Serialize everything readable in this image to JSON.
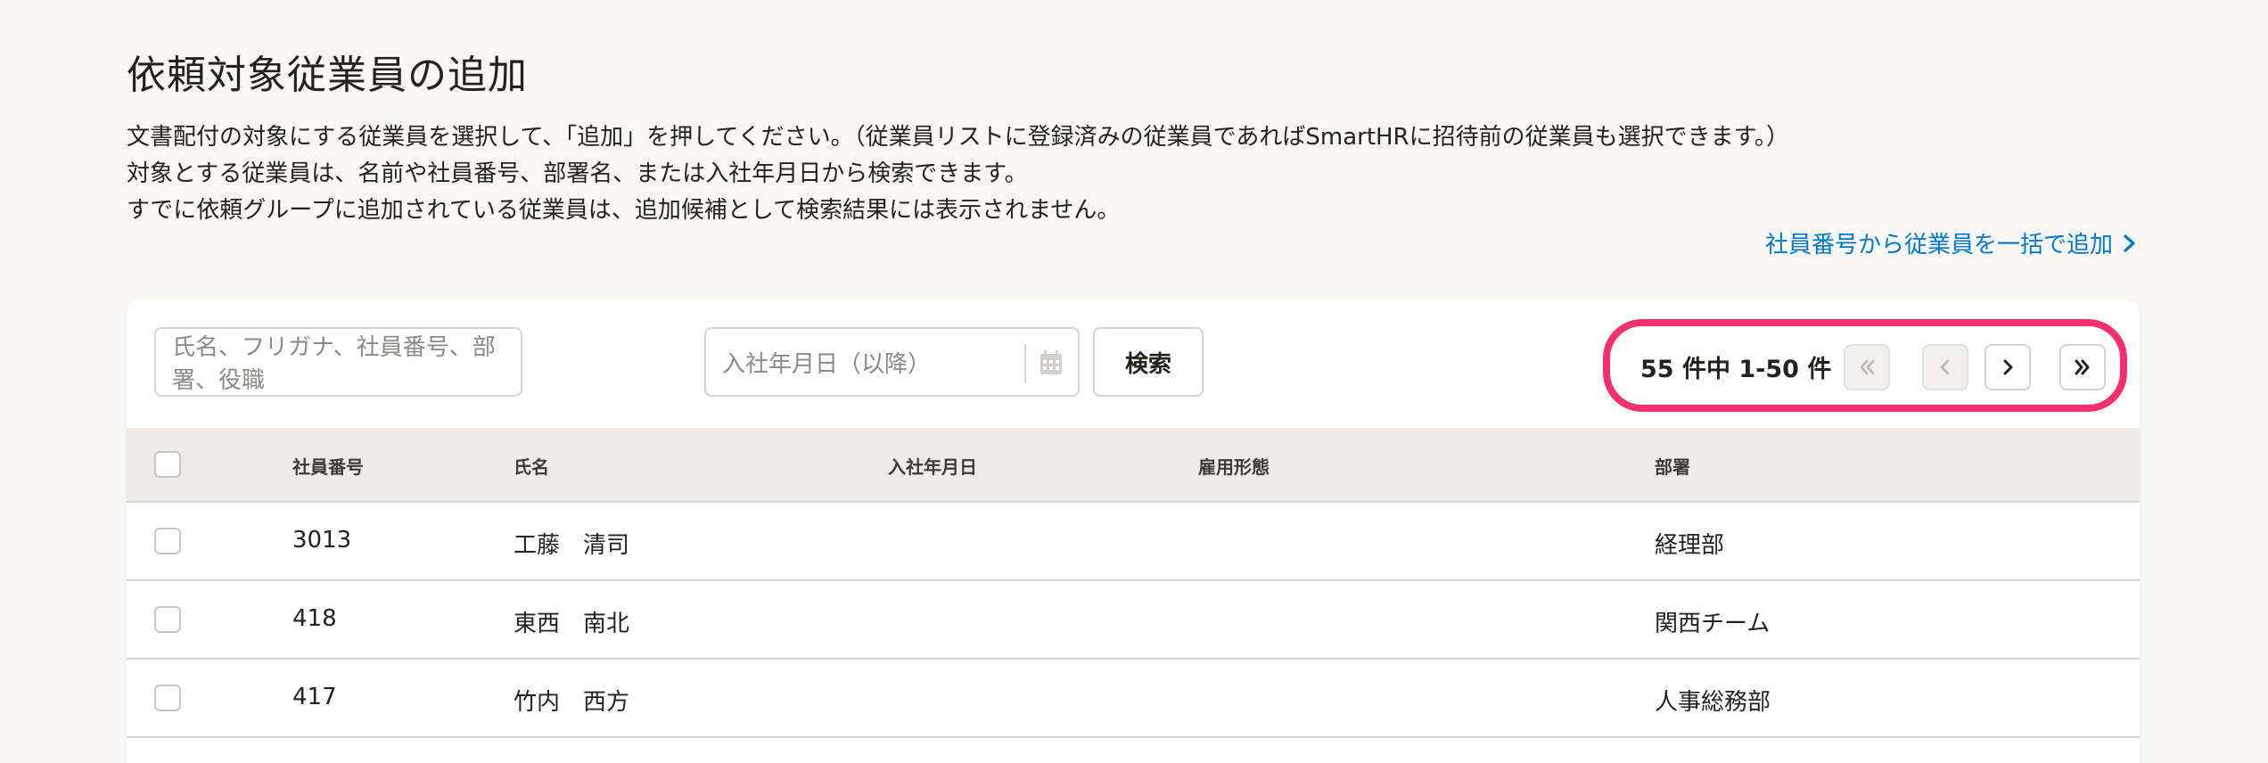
{
  "page": {
    "title": "依頼対象従業員の追加",
    "description": [
      "文書配付の対象にする従業員を選択して、「追加」を押してください。（従業員リストに登録済みの従業員であればSmartHRに招待前の従業員も選択できます。）",
      "対象とする従業員は、名前や社員番号、部署名、または入社年月日から検索できます。",
      "すでに依頼グループに追加されている従業員は、追加候補として検索結果には表示されません。"
    ],
    "bulk_add_link": "社員番号から従業員を一括で追加"
  },
  "search": {
    "name_placeholder": "氏名、フリガナ、社員番号、部署、役職",
    "date_placeholder": "入社年月日（以降）",
    "search_button": "検索"
  },
  "pagination": {
    "count_label": "55 件中 1-50 件",
    "total": 55,
    "range_start": 1,
    "range_end": 50
  },
  "table": {
    "headers": {
      "employee_number": "社員番号",
      "name": "氏名",
      "join_date": "入社年月日",
      "employment_type": "雇用形態",
      "department": "部署"
    },
    "rows": [
      {
        "employee_number": "3013",
        "name": "工藤　清司",
        "join_date": "",
        "employment_type": "",
        "department": "経理部"
      },
      {
        "employee_number": "418",
        "name": "東西　南北",
        "join_date": "",
        "employment_type": "",
        "department": "関西チーム"
      },
      {
        "employee_number": "417",
        "name": "竹内　西方",
        "join_date": "",
        "employment_type": "",
        "department": "人事総務部"
      }
    ]
  },
  "colors": {
    "link": "#0077c7",
    "highlight": "#f0306f",
    "header_bg": "#edebe8",
    "page_bg": "#f8f7f6"
  }
}
